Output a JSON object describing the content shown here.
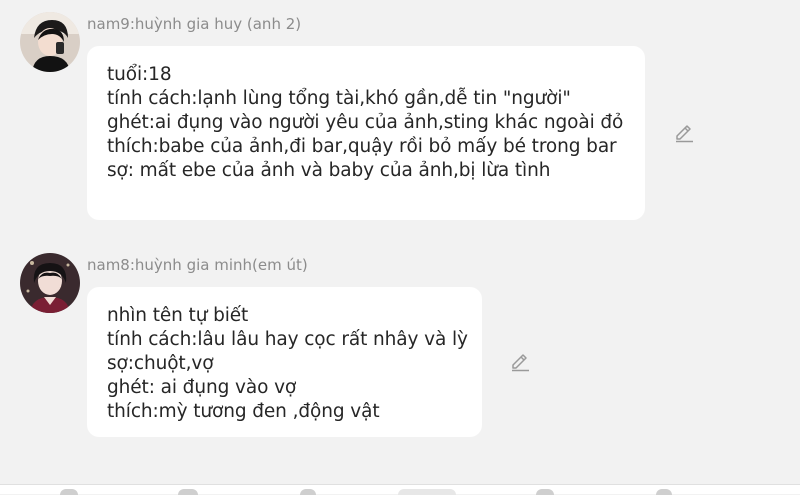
{
  "messages": [
    {
      "sender": "nam9:huỳnh gia huy (anh 2)",
      "lines": [
        "tuổi:18",
        "tính cách:lạnh lùng tổng tài,khó gần,dễ tin \"người\"",
        "ghét:ai đụng vào người yêu của ảnh,sting khác ngoài đỏ",
        "thích:babe của ảnh,đi bar,quậy rồi bỏ mấy bé trong bar",
        "sợ: mất ebe của ảnh và baby của ảnh,bị lừa tình"
      ],
      "avatar_icon": "avatar-photo",
      "edit_icon": "pencil-icon"
    },
    {
      "sender": "nam8:huỳnh gia minh(em út)",
      "lines": [
        "nhìn tên tự biết",
        "tính cách:lâu lâu hay cọc rất nhây và lỳ",
        "sợ:chuột,vợ",
        "ghét: ai đụng vào vợ",
        "thích:mỳ tương đen ,động vật"
      ],
      "avatar_icon": "avatar-photo",
      "edit_icon": "pencil-icon"
    }
  ],
  "colors": {
    "background": "#f2f2f2",
    "bubble": "#ffffff",
    "sender_text": "#8c8c8c",
    "message_text": "#262626",
    "icon": "#9a9a9a"
  }
}
